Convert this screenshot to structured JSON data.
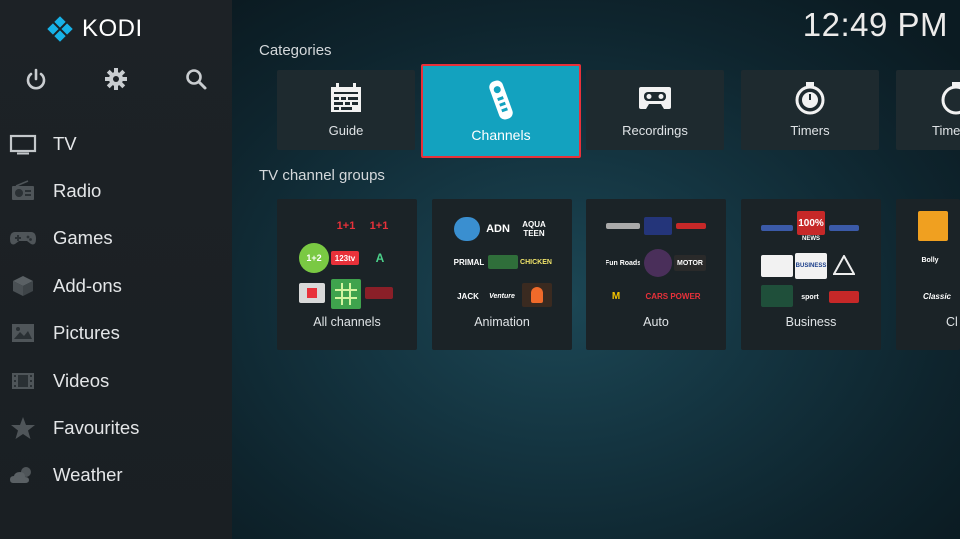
{
  "app": {
    "name": "KODI",
    "clock": "12:49 PM"
  },
  "top_icons": [
    "power-icon",
    "gear-icon",
    "search-icon"
  ],
  "sidebar": {
    "items": [
      {
        "label": "TV",
        "icon": "tv-icon"
      },
      {
        "label": "Radio",
        "icon": "radio-icon"
      },
      {
        "label": "Games",
        "icon": "gamepad-icon"
      },
      {
        "label": "Add-ons",
        "icon": "box-icon"
      },
      {
        "label": "Pictures",
        "icon": "picture-icon"
      },
      {
        "label": "Videos",
        "icon": "film-icon"
      },
      {
        "label": "Favourites",
        "icon": "star-icon"
      },
      {
        "label": "Weather",
        "icon": "weather-icon"
      }
    ]
  },
  "main": {
    "categories_title": "Categories",
    "categories": [
      {
        "label": "Guide",
        "icon": "guide-icon"
      },
      {
        "label": "Channels",
        "icon": "remote-icon",
        "focused": true
      },
      {
        "label": "Recordings",
        "icon": "cassette-icon"
      },
      {
        "label": "Timers",
        "icon": "stopwatch-icon"
      },
      {
        "label": "Time",
        "icon": "timer-icon"
      }
    ],
    "groups_title": "TV channel groups",
    "groups": [
      {
        "label": "All channels",
        "logos": [
          "1+1",
          "1+1",
          "1+2",
          "123tv",
          "A"
        ]
      },
      {
        "label": "Animation",
        "logos": [
          "ADN",
          "AQUA TEEN",
          "PRIMAL",
          "CHICKEN",
          "JACK",
          "Venture"
        ]
      },
      {
        "label": "Auto",
        "logos": [
          "Fun Roads",
          "MOTOR",
          "M",
          "CARS POWER"
        ]
      },
      {
        "label": "Business",
        "logos": [
          "100%",
          "NEWS",
          "BUSINESS",
          "sport"
        ]
      },
      {
        "label": "Cl",
        "logos": [
          "Bolly",
          "Classic"
        ]
      }
    ]
  },
  "colors": {
    "accent": "#13a2bf",
    "focus_border": "#e8313a",
    "sidebar": "#1d2226"
  }
}
